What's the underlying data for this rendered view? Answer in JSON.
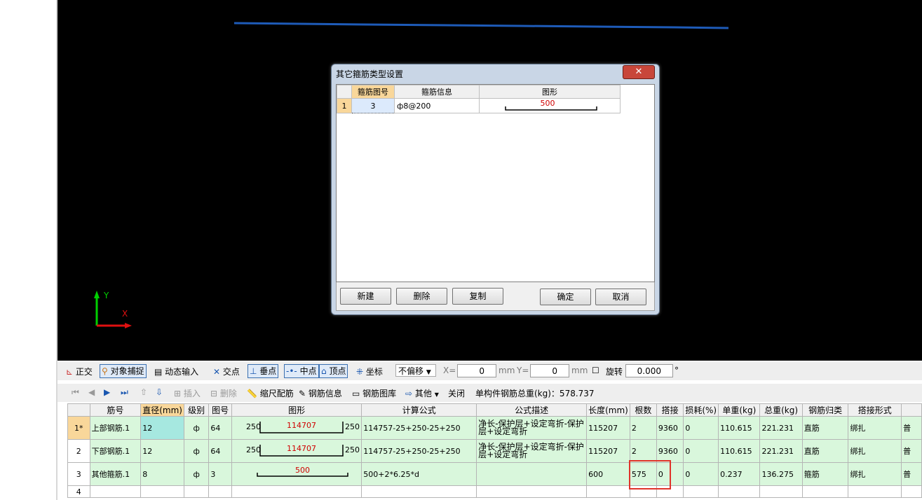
{
  "dialog": {
    "title": "其它箍筋类型设置",
    "close_label": "✕",
    "headers": [
      "箍筋图号",
      "箍筋信息",
      "图形"
    ],
    "rows": [
      {
        "index": "1",
        "figure_no": "3",
        "info": "ф8@200",
        "shape_value": "500"
      }
    ],
    "buttons": {
      "new": "新建",
      "delete": "删除",
      "copy": "复制",
      "ok": "确定",
      "cancel": "取消"
    }
  },
  "canvas": {
    "axis_y": "Y",
    "axis_x": "X"
  },
  "snap_toolbar": {
    "ortho": "正交",
    "object_snap": "对象捕捉",
    "dynamic_input": "动态输入",
    "intersection": "交点",
    "perpendicular": "垂点",
    "midpoint": "中点",
    "vertex": "顶点",
    "coordinate": "坐标",
    "offset_mode": "不偏移",
    "x_label": "X=",
    "x_value": "0",
    "mm1": "mm",
    "y_label": "Y=",
    "y_value": "0",
    "mm2": "mm",
    "rotate_label": "旋转",
    "rotate_value": "0.000",
    "degree": "°"
  },
  "rebar_toolbar": {
    "insert": "插入",
    "delete": "删除",
    "scale_rebar": "缩尺配筋",
    "rebar_info": "钢筋信息",
    "rebar_library": "钢筋图库",
    "other": "其他",
    "close": "关闭",
    "total_weight": "单构件钢筋总重(kg)：578.737"
  },
  "grid": {
    "headers": [
      "",
      "筋号",
      "直径(mm)",
      "级别",
      "图号",
      "图形",
      "计算公式",
      "公式描述",
      "长度(mm)",
      "根数",
      "搭接",
      "损耗(%)",
      "单重(kg)",
      "总重(kg)",
      "钢筋归类",
      "搭接形式",
      ""
    ],
    "rows": [
      {
        "idx": "1*",
        "name": "上部钢筋.1",
        "diameter": "12",
        "grade": "ф",
        "fig": "64",
        "left": "250",
        "mid": "114707",
        "right": "250",
        "formula": "114757-25+250-25+250",
        "desc1": "净长-保护层+设定弯折-保护",
        "desc2": "层+设定弯折",
        "length": "115207",
        "count": "2",
        "lap": "9360",
        "loss": "0",
        "unit_w": "110.615",
        "total_w": "221.231",
        "category": "直筋",
        "lap_form": "绑扎",
        "extra": "普"
      },
      {
        "idx": "2",
        "name": "下部钢筋.1",
        "diameter": "12",
        "grade": "ф",
        "fig": "64",
        "left": "250",
        "mid": "114707",
        "right": "250",
        "formula": "114757-25+250-25+250",
        "desc1": "净长-保护层+设定弯折-保护",
        "desc2": "层+设定弯折",
        "length": "115207",
        "count": "2",
        "lap": "9360",
        "loss": "0",
        "unit_w": "110.615",
        "total_w": "221.231",
        "category": "直筋",
        "lap_form": "绑扎",
        "extra": "普"
      },
      {
        "idx": "3",
        "name": "其他箍筋.1",
        "diameter": "8",
        "grade": "ф",
        "fig": "3",
        "left": "",
        "mid": "500",
        "right": "",
        "formula": "500+2*6.25*d",
        "desc1": "",
        "desc2": "",
        "length": "600",
        "count": "575",
        "lap": "0",
        "loss": "0",
        "unit_w": "0.237",
        "total_w": "136.275",
        "category": "箍筋",
        "lap_form": "绑扎",
        "extra": "普"
      }
    ],
    "empty_idx": "4"
  }
}
